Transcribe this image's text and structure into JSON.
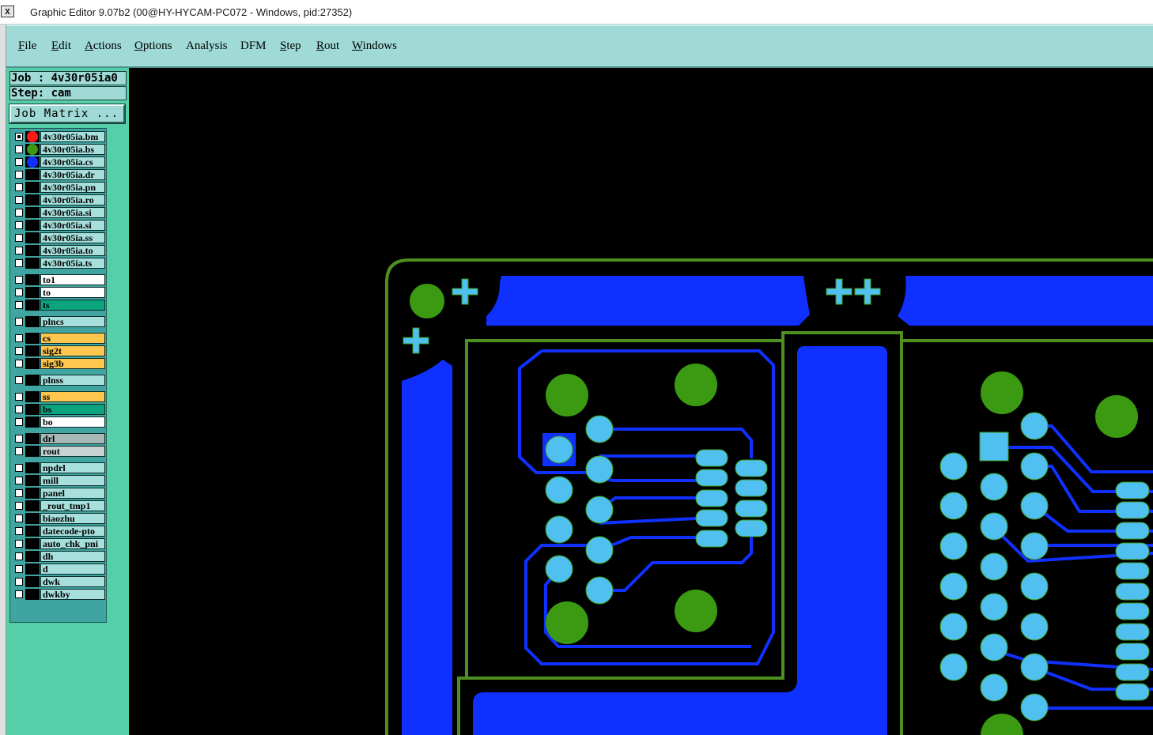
{
  "window": {
    "title": "Graphic Editor 9.07b2 (00@HY-HYCAM-PC072 - Windows, pid:27352)",
    "icon": "x-window-icon"
  },
  "menu": [
    {
      "pre": "",
      "mn": "F",
      "post": "ile"
    },
    {
      "pre": "",
      "mn": "E",
      "post": "dit"
    },
    {
      "pre": "",
      "mn": "A",
      "post": "ctions"
    },
    {
      "pre": "",
      "mn": "O",
      "post": "ptions"
    },
    {
      "pre": "Analysis",
      "mn": "",
      "post": ""
    },
    {
      "pre": "DFM",
      "mn": "",
      "post": ""
    },
    {
      "pre": "",
      "mn": "S",
      "post": "tep"
    },
    {
      "pre": "",
      "mn": "R",
      "post": "out"
    },
    {
      "pre": "",
      "mn": "W",
      "post": "indows"
    }
  ],
  "job_label": "Job : 4v30r05ia0",
  "step_label": "Step: cam",
  "matrix_button": "Job Matrix ...",
  "colors": {
    "red": "#ff1a1a",
    "green": "#3b9a12",
    "blue": "#1030ff",
    "lightblue": "#4fc0f0",
    "panel": "#55cfa8",
    "menubar": "#9fdad6",
    "outline": "#4f8f1f",
    "layer_ltcyan": "#a6dfdc",
    "layer_white": "#ffffff",
    "layer_teal": "#0aa57f",
    "layer_orange": "#ffc64d",
    "layer_gray": "#a7b8b7",
    "layer_ltgray": "#c6d3d2"
  },
  "layers": [
    {
      "name": "4v30r05ia.bm",
      "bg": "layer_ltcyan",
      "dot": "red",
      "checked": true
    },
    {
      "name": "4v30r05ia.bs",
      "bg": "layer_ltcyan",
      "dot": "green",
      "checked": false
    },
    {
      "name": "4v30r05ia.cs",
      "bg": "layer_ltcyan",
      "dot": "blue",
      "checked": false
    },
    {
      "name": "4v30r05ia.dr",
      "bg": "layer_ltcyan",
      "dot": "",
      "checked": false
    },
    {
      "name": "4v30r05ia.pn",
      "bg": "layer_ltcyan",
      "dot": "",
      "checked": false
    },
    {
      "name": "4v30r05ia.ro",
      "bg": "layer_ltcyan",
      "dot": "",
      "checked": false
    },
    {
      "name": "4v30r05ia.si",
      "bg": "layer_ltcyan",
      "dot": "",
      "checked": false
    },
    {
      "name": "4v30r05ia.si",
      "bg": "layer_ltcyan",
      "dot": "",
      "checked": false
    },
    {
      "name": "4v30r05ia.ss",
      "bg": "layer_ltcyan",
      "dot": "",
      "checked": false
    },
    {
      "name": "4v30r05ia.to",
      "bg": "layer_ltcyan",
      "dot": "",
      "checked": false
    },
    {
      "name": "4v30r05ia.ts",
      "bg": "layer_ltcyan",
      "dot": "",
      "checked": false
    },
    {
      "name": "to1",
      "bg": "layer_white",
      "dot": "",
      "checked": false,
      "gap": true
    },
    {
      "name": "to",
      "bg": "layer_white",
      "dot": "",
      "checked": false
    },
    {
      "name": "ts",
      "bg": "layer_teal",
      "dot": "",
      "checked": false
    },
    {
      "name": "plncs",
      "bg": "layer_ltcyan",
      "dot": "",
      "checked": false,
      "gap": true
    },
    {
      "name": "cs",
      "bg": "layer_orange",
      "dot": "",
      "checked": false,
      "gap": true
    },
    {
      "name": "sig2t",
      "bg": "layer_orange",
      "dot": "",
      "checked": false
    },
    {
      "name": "sig3b",
      "bg": "layer_orange",
      "dot": "",
      "checked": false
    },
    {
      "name": "plnss",
      "bg": "layer_ltcyan",
      "dot": "",
      "checked": false,
      "gap": true
    },
    {
      "name": "ss",
      "bg": "layer_orange",
      "dot": "",
      "checked": false,
      "gap": true
    },
    {
      "name": "bs",
      "bg": "layer_teal",
      "dot": "",
      "checked": false
    },
    {
      "name": "bo",
      "bg": "layer_white",
      "dot": "",
      "checked": false
    },
    {
      "name": "drl",
      "bg": "layer_gray",
      "dot": "",
      "checked": false,
      "gap": true
    },
    {
      "name": "rout",
      "bg": "layer_ltgray",
      "dot": "",
      "checked": false
    },
    {
      "name": "npdrl",
      "bg": "layer_ltcyan",
      "dot": "",
      "checked": false,
      "gap": true
    },
    {
      "name": "mill",
      "bg": "layer_ltcyan",
      "dot": "",
      "checked": false
    },
    {
      "name": "panel",
      "bg": "layer_ltcyan",
      "dot": "",
      "checked": false
    },
    {
      "name": "_rout_tmp1",
      "bg": "layer_ltcyan",
      "dot": "",
      "checked": false
    },
    {
      "name": "biaozhu",
      "bg": "layer_ltcyan",
      "dot": "",
      "checked": false
    },
    {
      "name": "datecode-pto",
      "bg": "layer_ltcyan",
      "dot": "",
      "checked": false
    },
    {
      "name": "auto_chk_pni",
      "bg": "layer_ltcyan",
      "dot": "",
      "checked": false
    },
    {
      "name": "dh",
      "bg": "layer_ltcyan",
      "dot": "",
      "checked": false
    },
    {
      "name": "d",
      "bg": "layer_ltcyan",
      "dot": "",
      "checked": false
    },
    {
      "name": "dwk",
      "bg": "layer_ltcyan",
      "dot": "",
      "checked": false
    },
    {
      "name": "dwkby",
      "bg": "layer_ltcyan",
      "dot": "",
      "checked": false
    }
  ]
}
